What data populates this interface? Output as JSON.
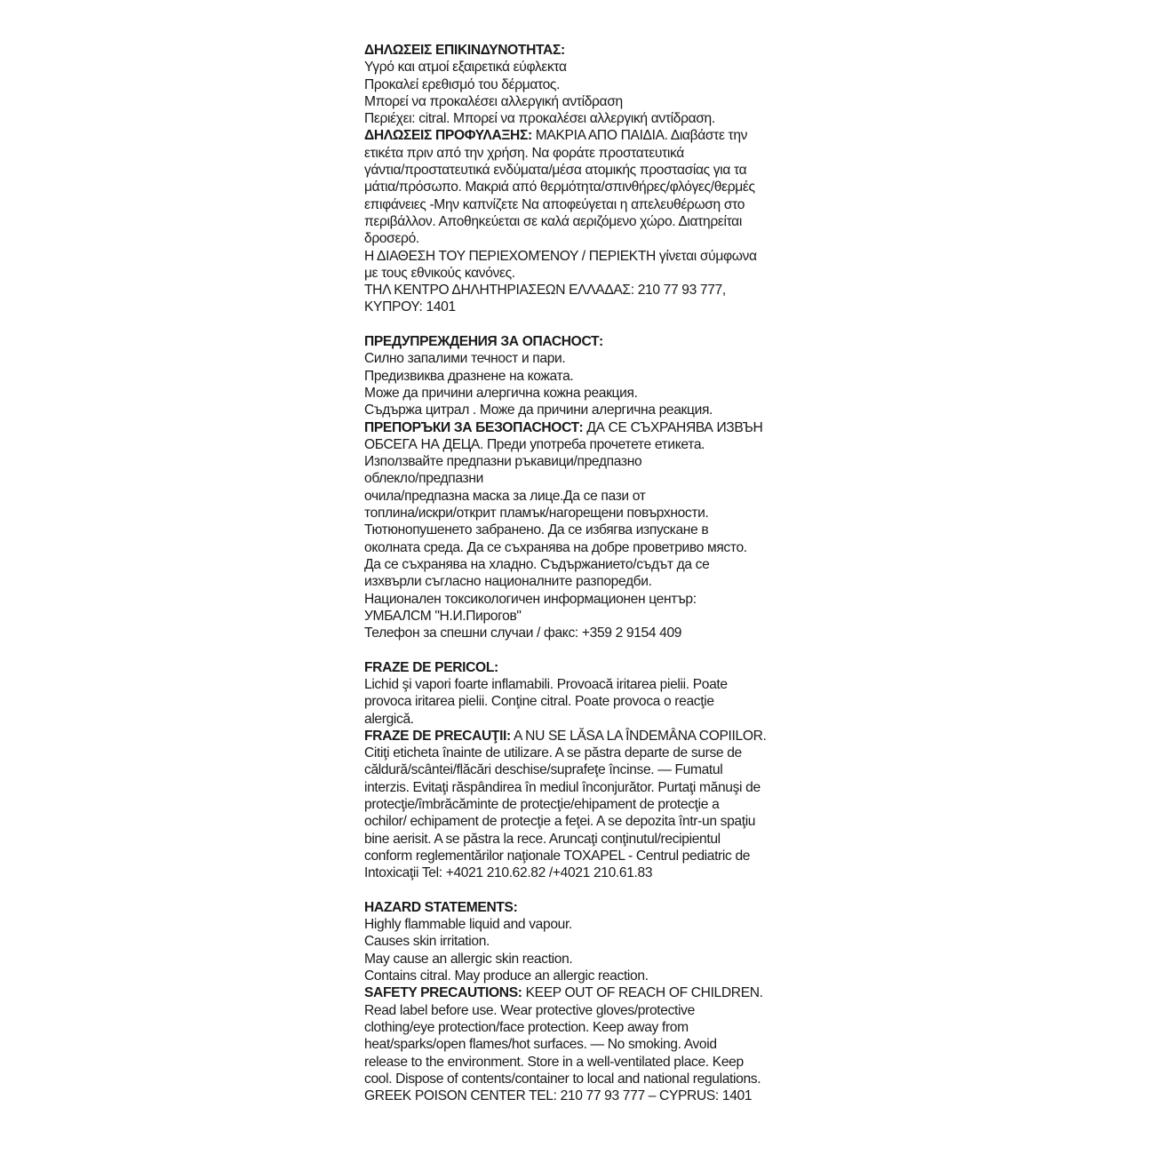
{
  "sections": [
    {
      "lang": "greek",
      "lines": [
        [
          {
            "t": "ΔΗΛΩΣΕΙΣ ΕΠΙΚΙΝΔΥΝΟΤΗΤΑΣ:",
            "b": true
          }
        ],
        [
          {
            "t": "Υγρό και ατμοί εξαιρετικά εύφλεκτα"
          }
        ],
        [
          {
            "t": "Προκαλεί ερεθισμό του δέρματος."
          }
        ],
        [
          {
            "t": "Μπορεί να προκαλέσει αλλεργική αντίδραση"
          }
        ],
        [
          {
            "t": "Περιέχει: citral. Μπορεί να προκαλέσει αλλεργική αντίδραση."
          }
        ],
        [
          {
            "t": "ΔΗΛΩΣΕΙΣ ΠΡΟΦΥΛΑΞΗΣ:",
            "b": true
          },
          {
            "t": " ΜΑΚΡΙΑ ΑΠΟ ΠΑΙΔΙΑ. Διαβάστε την"
          }
        ],
        [
          {
            "t": "ετικέτα πριν από την χρήση. Να φοράτε προστατευτικά"
          }
        ],
        [
          {
            "t": "γάντια/προστατευτικά ενδύματα/μέσα ατομικής προστασίας για τα"
          }
        ],
        [
          {
            "t": "μάτια/πρόσωπο. Μακριά από θερμότητα/σπινθήρες/φλόγες/θερμές"
          }
        ],
        [
          {
            "t": "επιφάνειες -Μην καπνίζετε Να αποφεύγεται η απελευθέρωση στο"
          }
        ],
        [
          {
            "t": "περιβάλλον. Αποθηκεύεται σε καλά αεριζόμενο χώρο. Διατηρείται"
          }
        ],
        [
          {
            "t": "δροσερό."
          }
        ],
        [
          {
            "t": "Η ΔΙΑΘΕΣΗ ΤΟΥ ΠΕΡΙΕΧΟΜΈΝΟΥ / ΠΕΡΙΕΚΤΗ γίνεται σύμφωνα"
          }
        ],
        [
          {
            "t": "με τους εθνικούς κανόνες."
          }
        ],
        [
          {
            "t": "ΤΗΛ ΚΕΝΤΡΟ ΔΗΛΗΤΗΡΙΑΣΕΩΝ ΕΛΛΑΔΑΣ: 210 77 93 777,"
          }
        ],
        [
          {
            "t": "ΚΥΠΡΟΥ: 1401"
          }
        ]
      ]
    },
    {
      "lang": "bulgarian",
      "lines": [
        [
          {
            "t": "ПРЕДУПРЕЖДЕНИЯ ЗА ОПАСНОСТ:",
            "b": true
          }
        ],
        [
          {
            "t": "Силно запалими течност и пари."
          }
        ],
        [
          {
            "t": "Предизвиква дразнене на кожата."
          }
        ],
        [
          {
            "t": "Може да причини алергична кожна реакция."
          }
        ],
        [
          {
            "t": "Съдържа  цитрал . Може да причини алергична реакция."
          }
        ],
        [
          {
            "t": "ПРЕПОРЪКИ ЗА БЕЗОПАСНОСТ:",
            "b": true
          },
          {
            "t": " ДА СЕ СЪХРАНЯВА ИЗВЪН"
          }
        ],
        [
          {
            "t": "ОБСЕГА НА ДЕЦА. Преди употреба прочетете етикета."
          }
        ],
        [
          {
            "t": "Използвайте предпазни ръкавици/предпазно"
          }
        ],
        [
          {
            "t": "облекло/предпазни"
          }
        ],
        [
          {
            "t": "очила/предпазна маска за лице.Да се пази от"
          }
        ],
        [
          {
            "t": "топлина/искри/открит пламък/нагорещени повърхности."
          }
        ],
        [
          {
            "t": "Тютюнопушенето забранено. Да се избягва изпускане в"
          }
        ],
        [
          {
            "t": "околната среда. Да се съхранява на добре проветриво място."
          }
        ],
        [
          {
            "t": "Да се съхранява на хладно. Съдържанието/съдът да се"
          }
        ],
        [
          {
            "t": "изхвърли съгласно националните разпоредби."
          }
        ],
        [
          {
            "t": "Национален токсикологичен информационен център:"
          }
        ],
        [
          {
            "t": "УМБАЛСМ \"Н.И.Пирогов\""
          }
        ],
        [
          {
            "t": "Телефон за спешни случаи / факс: +359 2 9154 409"
          }
        ]
      ]
    },
    {
      "lang": "romanian",
      "lines": [
        [
          {
            "t": "FRAZE DE PERICOL:",
            "b": true
          }
        ],
        [
          {
            "t": "Lichid şi vapori foarte inflamabili. Provoacă iritarea pielii. Poate"
          }
        ],
        [
          {
            "t": "provoca iritarea pielii. Conţine citral. Poate provoca o reacţie"
          }
        ],
        [
          {
            "t": "alergică."
          }
        ],
        [
          {
            "t": "FRAZE DE PRECAUŢII:",
            "b": true
          },
          {
            "t": " A NU SE LĂSA LA ÎNDEMÂNA COPIILOR."
          }
        ],
        [
          {
            "t": "Citiţi eticheta înainte de utilizare. A se păstra departe de surse de"
          }
        ],
        [
          {
            "t": "căldură/scântei/flăcări deschise/suprafeţe încinse. — Fumatul"
          }
        ],
        [
          {
            "t": "interzis. Evitaţi răspândirea în mediul înconjurător. Purtaţi mănuşi de"
          }
        ],
        [
          {
            "t": "protecţie/îmbrăcăminte de protecţie/ehipament de protecţie a"
          }
        ],
        [
          {
            "t": "ochilor/ echipament de protecţie a feţei. A se depozita într-un spaţiu"
          }
        ],
        [
          {
            "t": "bine aerisit. A se păstra la rece. Aruncaţi conţinutul/recipientul"
          }
        ],
        [
          {
            "t": "conform reglementărilor naţionale TOXAPEL - Centrul pediatric de"
          }
        ],
        [
          {
            "t": "Intoxicaţii Tel: +4021 210.62.82  /+4021 210.61.83"
          }
        ]
      ]
    },
    {
      "lang": "english",
      "lines": [
        [
          {
            "t": "HAZARD STATEMENTS:",
            "b": true
          }
        ],
        [
          {
            "t": "Highly flammable liquid and vapour."
          }
        ],
        [
          {
            "t": "Causes skin irritation."
          }
        ],
        [
          {
            "t": "May cause an allergic skin reaction."
          }
        ],
        [
          {
            "t": "Contains citral. May produce an allergic reaction."
          }
        ],
        [
          {
            "t": "SAFETY PRECAUTIONS:",
            "b": true
          },
          {
            "t": " KEEP OUT OF REACH OF CHILDREN."
          }
        ],
        [
          {
            "t": "Read label before use. Wear protective gloves/protective"
          }
        ],
        [
          {
            "t": "clothing/eye protection/face protection. Keep away from"
          }
        ],
        [
          {
            "t": "heat/sparks/open flames/hot surfaces. — No smoking. Avoid"
          }
        ],
        [
          {
            "t": "release to the environment. Store in a well-ventilated place. Keep"
          }
        ],
        [
          {
            "t": "cool. Dispose of contents/container to local and national regulations."
          }
        ],
        [
          {
            "t": "GREEK POISON CENTER TEL: 210 77 93 777 – CYPRUS: 1401"
          }
        ]
      ]
    }
  ]
}
